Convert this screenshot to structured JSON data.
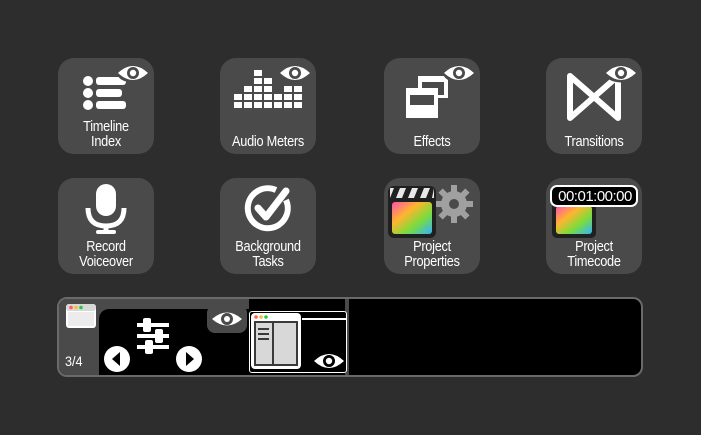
{
  "tiles": [
    {
      "id": "timeline-index",
      "label": "Timeline\nIndex",
      "icon": "timeline-index-icon",
      "has_eye": true
    },
    {
      "id": "audio-meters",
      "label": "Audio Meters",
      "icon": "audio-meters-icon",
      "has_eye": true
    },
    {
      "id": "effects",
      "label": "Effects",
      "icon": "effects-icon",
      "has_eye": true
    },
    {
      "id": "transitions",
      "label": "Transitions",
      "icon": "transitions-icon",
      "has_eye": true
    },
    {
      "id": "record-voiceover",
      "label": "Record\nVoiceover",
      "icon": "microphone-icon",
      "has_eye": false
    },
    {
      "id": "background-tasks",
      "label": "Background\nTasks",
      "icon": "checkmark-circle-icon",
      "has_eye": false
    },
    {
      "id": "project-properties",
      "label": "Project\nProperties",
      "icon": "final-cut-gear-icon",
      "has_eye": false
    },
    {
      "id": "project-timecode",
      "label": "Project\nTimecode",
      "icon": "final-cut-timecode-icon",
      "has_eye": false
    }
  ],
  "timecode_display": "00:01:00:00",
  "strip": {
    "page_indicator": "3/4",
    "icons": [
      "browser-window-icon",
      "sliders-icon",
      "eye-icon",
      "previous-arrow-icon",
      "next-arrow-icon",
      "window-layout-icon",
      "eye-icon"
    ]
  },
  "colors": {
    "background": "#2d2d2d",
    "tile": "#4a4a4a",
    "foreground": "#ffffff",
    "strip_background": "#000000"
  }
}
